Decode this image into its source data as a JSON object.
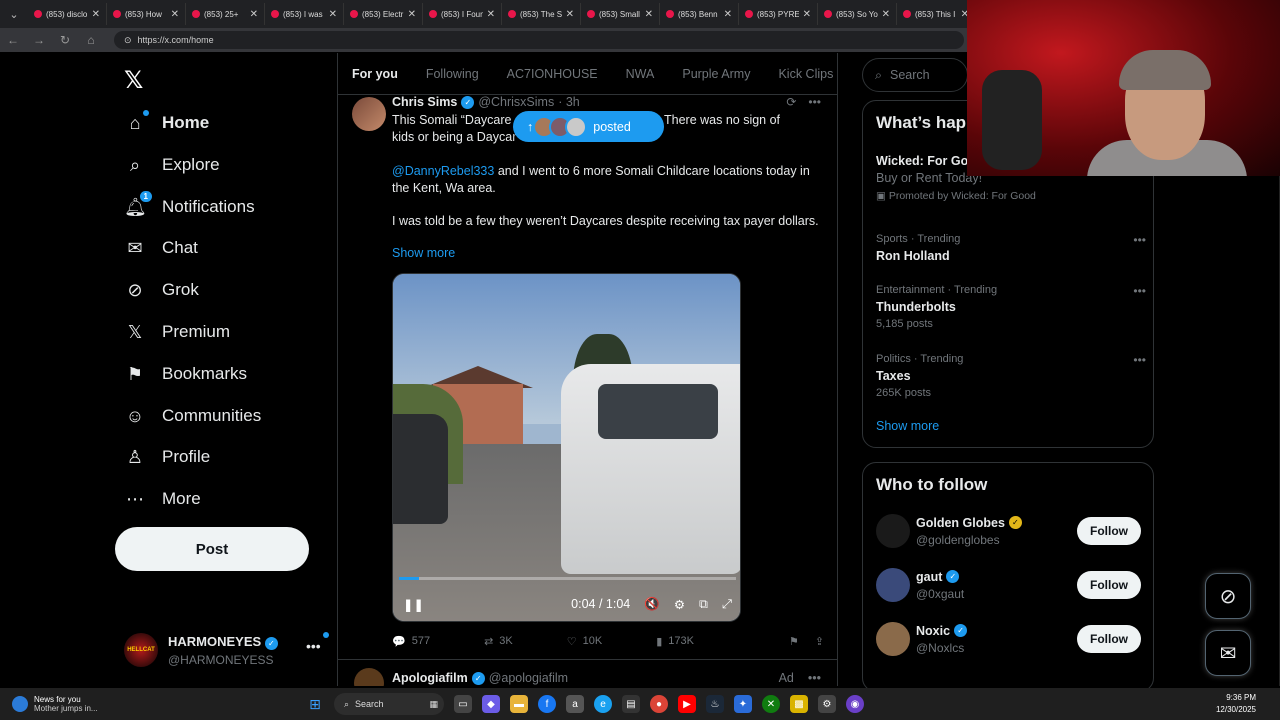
{
  "browser": {
    "tabs": [
      {
        "title": "(853) disclo"
      },
      {
        "title": "(853) How"
      },
      {
        "title": "(853) 25+"
      },
      {
        "title": "(853) I was"
      },
      {
        "title": "(853) Electr"
      },
      {
        "title": "(853) I Foun"
      },
      {
        "title": "(853) The S"
      },
      {
        "title": "(853) Small"
      },
      {
        "title": "(853) Benn"
      },
      {
        "title": "(853) PYRE"
      },
      {
        "title": "(853) So Yo"
      },
      {
        "title": "(853) This I"
      }
    ],
    "url": "https://x.com/home"
  },
  "sidebar": {
    "items": [
      {
        "label": "Home",
        "icon": "home-icon"
      },
      {
        "label": "Explore",
        "icon": "search-icon"
      },
      {
        "label": "Notifications",
        "icon": "bell-icon",
        "badge": "1"
      },
      {
        "label": "Chat",
        "icon": "mail-icon"
      },
      {
        "label": "Grok",
        "icon": "grok-icon"
      },
      {
        "label": "Premium",
        "icon": "x-icon"
      },
      {
        "label": "Bookmarks",
        "icon": "bookmark-icon"
      },
      {
        "label": "Communities",
        "icon": "people-icon"
      },
      {
        "label": "Profile",
        "icon": "person-icon"
      },
      {
        "label": "More",
        "icon": "more-circle-icon"
      }
    ],
    "post_label": "Post",
    "account": {
      "name": "HARMONEYES",
      "handle": "@HARMONEYESS",
      "avatar_text": "HELLCAT"
    }
  },
  "timeline": {
    "tabs": [
      "For you",
      "Following",
      "AC7IONHOUSE",
      "NWA",
      "Purple Army",
      "Kick Clips"
    ],
    "new_posts_label": "posted",
    "tweet": {
      "name": "Chris Sims",
      "handle": "@ChrisxSims",
      "time": "· 3h",
      "text1_a": "This Somali “Daycare",
      "text1_b": "e me. There was no sign of",
      "text1_c": "kids or being a Daycar",
      "mention": "@DannyRebel333",
      "text2": " and I went to 6 more Somali Childcare locations today in the Kent, Wa area.",
      "text3": "I was told be a few they weren’t Daycares despite receiving tax payer dollars.",
      "show_more": "Show more",
      "video_time": "0:04 / 1:04",
      "video_progress": 0.06,
      "replies": "577",
      "reposts": "3K",
      "likes": "10K",
      "views": "173K"
    },
    "tweet2": {
      "name": "Apologiafilm",
      "handle": "@apologiafilm",
      "ad": "Ad"
    }
  },
  "right": {
    "search_placeholder": "Search",
    "happening_title": "What’s hap",
    "promo": {
      "title": "Wicked: For Go",
      "subtitle": "Buy or Rent Today!",
      "by": "Promoted by Wicked: For Good"
    },
    "trends": [
      {
        "meta": "Sports · Trending",
        "title": "Ron Holland",
        "count": ""
      },
      {
        "meta": "Entertainment · Trending",
        "title": "Thunderbolts",
        "count": "5,185 posts"
      },
      {
        "meta": "Politics · Trending",
        "title": "Taxes",
        "count": "265K posts"
      }
    ],
    "show_more": "Show more",
    "who_title": "Who to follow",
    "follow_label": "Follow",
    "who": [
      {
        "name": "Golden Globes",
        "handle": "@goldenglobes",
        "verified": "gold",
        "avatar_color": "#1a1a1a"
      },
      {
        "name": "gaut",
        "handle": "@0xgaut",
        "verified": "blue",
        "avatar_color": "#3a4a7a"
      },
      {
        "name": "Noxic",
        "handle": "@Noxlcs",
        "verified": "blue",
        "avatar_color": "#8a6a4a"
      }
    ]
  },
  "taskbar": {
    "news_title": "News for you",
    "news_sub": "Mother jumps in...",
    "search": "Search",
    "time": "9:36 PM",
    "date": "12/30/2025"
  }
}
